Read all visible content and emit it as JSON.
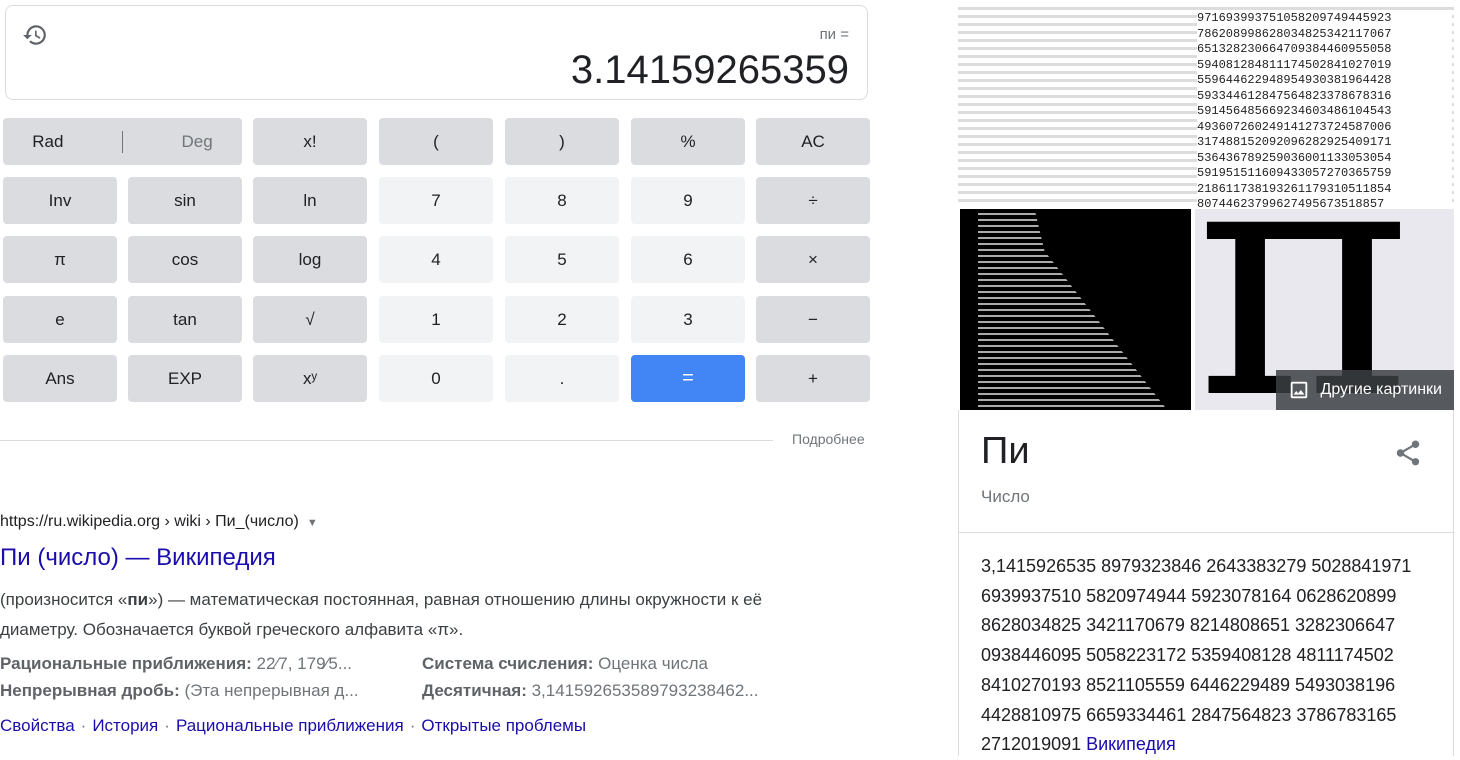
{
  "calculator": {
    "expression": "пи =",
    "result": "3.14159265359",
    "rad": "Rad",
    "deg": "Deg",
    "buttons": [
      [
        "x!",
        "(",
        ")",
        "%",
        "AC"
      ],
      [
        "Inv",
        "sin",
        "ln",
        "7",
        "8",
        "9",
        "÷"
      ],
      [
        "π",
        "cos",
        "log",
        "4",
        "5",
        "6",
        "×"
      ],
      [
        "e",
        "tan",
        "√",
        "1",
        "2",
        "3",
        "−"
      ],
      [
        "Ans",
        "EXP",
        "xʸ",
        "0",
        ".",
        "=",
        "+"
      ]
    ],
    "more": "Подробнее",
    "accent": "#4285f4"
  },
  "result": {
    "url": "https://ru.wikipedia.org › wiki › Пи_(число)",
    "title": "Пи (число) — Википедия",
    "snippet_pre": "(произносится «",
    "snippet_bold": "пи",
    "snippet_post": "») — математическая постоянная, равная отношению длины окружности к её диаметру. Обозначается буквой греческого алфавита «π».",
    "facts": [
      {
        "label": "Рациональные приближения:",
        "value": " 22⁄7, 179⁄5..."
      },
      {
        "label": "Система счисления:",
        "value": " Оценка числа"
      },
      {
        "label": "Непрерывная дробь:",
        "value": " (Эта непрерывная д..."
      },
      {
        "label": "Десятичная:",
        "value": " 3,14159265358979323846​2..."
      }
    ],
    "links": [
      "Свойства",
      "История",
      "Рациональные приближения",
      "Открытые проблемы"
    ]
  },
  "knowledge": {
    "more_images": "Другие картинки",
    "title": "Пи",
    "subtitle": "Число",
    "digits": [
      "3,1415926535 8979323846 2643383279 5028841971",
      "6939937510 5820974944 5923078164 0628620899",
      "8628034825 3421170679 8214808651 3282306647",
      "0938446095 5058223172 5359408128 4811174502",
      "8410270193 8521105559 6446229489 5493038196",
      "4428810975 6659334461 2847564823 3786783165",
      "2712019091"
    ],
    "source": "Википедия"
  }
}
